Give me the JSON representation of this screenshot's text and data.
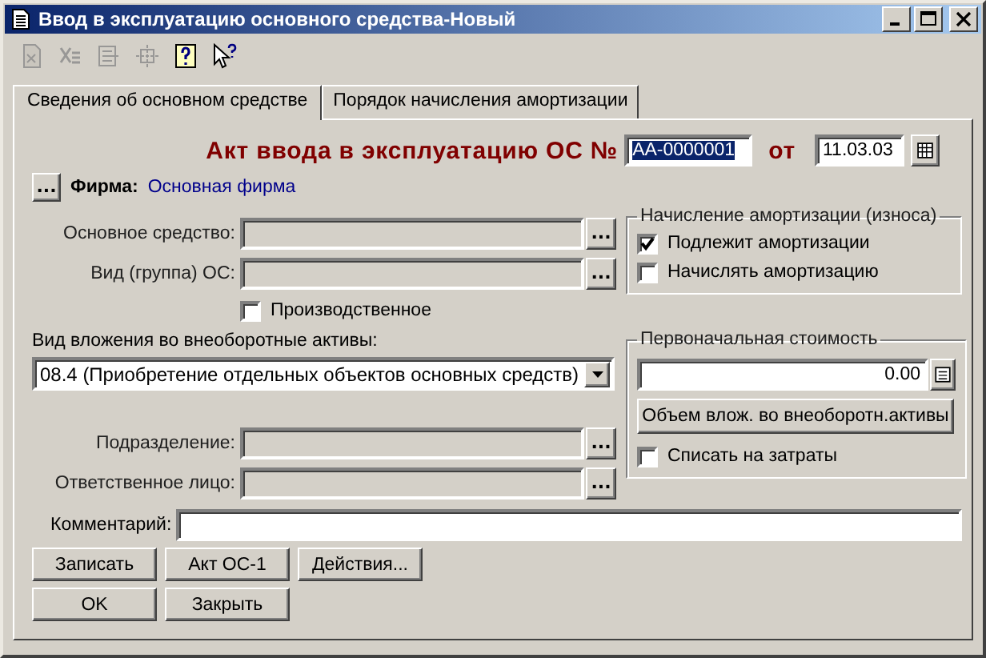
{
  "window": {
    "title": "Ввод в эксплуатацию основного средства-Новый"
  },
  "toolbar": [
    {
      "disabled": true
    },
    {
      "disabled": true
    },
    {
      "disabled": true
    },
    {
      "disabled": true
    },
    {
      "disabled": false
    },
    {
      "disabled": false
    }
  ],
  "tabs": [
    {
      "label": "Сведения об основном средстве",
      "selected": true
    },
    {
      "label": "Порядок начисления амортизации",
      "selected": false
    }
  ],
  "act": {
    "title": "Акт ввода в эксплуатацию ОС №",
    "number": "АА-0000001",
    "number_selected": true,
    "date_label": "от",
    "date": "11.03.03"
  },
  "firm": {
    "button": "...",
    "label": "Фирма:",
    "value": "Основная фирма"
  },
  "fields": [
    {
      "label": "Основное средство:",
      "button": "..."
    },
    {
      "label": "Вид (группа) ОС:",
      "button": "..."
    }
  ],
  "production": {
    "label": "Производственное",
    "checked": false
  },
  "investment": {
    "label": "Вид вложения во внеоборотные активы:",
    "value": "08.4 (Приобретение отдельных объектов основных средств)"
  },
  "fields2": [
    {
      "label": "Подразделение:",
      "button": "..."
    },
    {
      "label": "Ответственное лицо:",
      "button": "..."
    }
  ],
  "depreciation": {
    "title": "Начисление амортизации (износа)",
    "options": [
      {
        "label": "Подлежит амортизации",
        "checked": true
      },
      {
        "label": "Начислять амортизацию",
        "checked": false
      }
    ]
  },
  "initial_cost": {
    "title": "Первоначальная стоимость",
    "value": "0.00",
    "button": "Объем влож. во внеоборотн.активы",
    "write_off": {
      "label": "Списать на затраты",
      "checked": false
    }
  },
  "comment": {
    "label": "Комментарий:"
  },
  "buttons": [
    [
      "Записать",
      "Акт ОС-1",
      "Действия..."
    ],
    [
      "OK",
      "Закрыть"
    ]
  ]
}
